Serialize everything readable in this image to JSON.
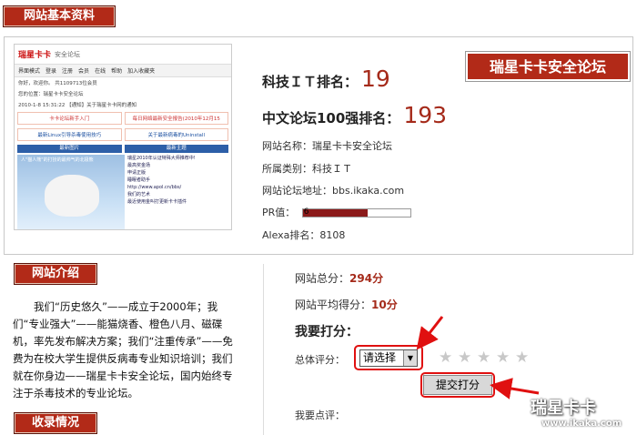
{
  "section_header": "网站基本资料",
  "thumbnail": {
    "logo": "瑞星卡卡",
    "logo_sub": "安全论坛",
    "menu": [
      "界面模式",
      "登录",
      "注册",
      "会员",
      "在线",
      "帮助",
      "加入收藏夹"
    ],
    "greeting": "你好，欢迎你。",
    "stats": "共1109713位会员",
    "position": "您的位置：瑞星卡卡安全论坛",
    "notice": "2010-1-8 15:31:22 【通知】关于瑞星卡卡网的通知",
    "feature_boxes": [
      "卡卡论坛新手入门",
      "每日网络最新安全报告(2010年12月15"
    ],
    "feature_boxes2": [
      "最新Linux引导杀毒使用技巧",
      "关于最新病毒的Uninstall"
    ],
    "tabs": [
      "最新图片",
      "最新主题"
    ],
    "photo_caption": "人\"猫人熊\"的打扮的最帅气的北极熊",
    "list_items": [
      "瑞星2010年认证特殊大师推荐中!",
      "最高奖金场",
      "申请正版",
      "睡眠者助手",
      "http://www.apol.cn/bbs/",
      "我们的艺术",
      "最近使用金叫打更新卡卡插件"
    ]
  },
  "banner": "瑞星卡卡安全论坛",
  "rank_it": {
    "label": "科技ＩＴ排名：",
    "value": "19"
  },
  "rank_cn": {
    "label": "中文论坛100强排名：",
    "value": "193"
  },
  "site_name": "网站名称：瑞星卡卡安全论坛",
  "category": "所属类别：科技ＩＴ",
  "site_url": "网站论坛地址：bbs.ikaka.com",
  "pr": {
    "label": "PR值：",
    "value": "6",
    "fraction": 0.6
  },
  "alexa": "Alexa排名：8108",
  "intro_header": "网站介绍",
  "intro_text": "我们“历史悠久”——成立于2000年；我们“专业强大”——能猫烧香、橙色八月、磁碟机，率先发布解决方案；我们“注重传承”——免费为在校大学生提供反病毒专业知识培训；我们就在你身边——瑞星卡卡安全论坛，国内始终专注于杀毒技术的专业论坛。",
  "records_header": "收录情况",
  "total_score": {
    "label": "网站总分：",
    "value": "294分"
  },
  "avg_score": {
    "label": "网站平均得分：",
    "value": "10分"
  },
  "rate_title": "我要打分：",
  "overall_label": "总体评分：",
  "select_value": "请选择",
  "submit_label": "提交打分",
  "comment_label": "我要点评：",
  "watermark": {
    "main": "瑞星卡卡",
    "url": "www.ikaka.com"
  },
  "colors": {
    "brand_red": "#b22a18",
    "score_red": "#a52a1a",
    "highlight_red": "#e01010"
  }
}
